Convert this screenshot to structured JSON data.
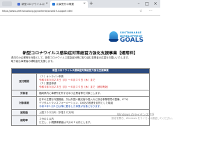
{
  "browser": {
    "tabs": [
      {
        "title": "新型コロナウイルス感染症対策経営力",
        "active": false
      },
      {
        "title": "応募受付の概要",
        "active": true
      }
    ],
    "new_tab_glyph": "+",
    "url": "https://www.pref.fukuoka.lg.jp/contents/covid19-support.html"
  },
  "logo": {
    "line1": "SUSTAINABLE",
    "line2": "DEVELOPMENT",
    "line3": "GOALS"
  },
  "page": {
    "title": "新型コロナウイルス感染症対策経営力強化支援事業【通常枠】",
    "intro_line1": "県内中小企業等を対象として、新型コロナウイルス感染症対策に取り組む事業者の応募をお願いいたします。",
    "intro_line2": "取り組む事業者の補助金を支援します。"
  },
  "table": {
    "header": "新型コロナウイルス感染症対策経営力強化支援事業",
    "rows": [
      {
        "label": "受付期間",
        "lines": [
          {
            "text": "（１）オンライン申請",
            "color": "normal"
          },
          {
            "text": "令和４年５月２３日（月）～６月３０日（木）まで",
            "color": "red"
          },
          {
            "text": "（２）郵送申請",
            "color": "normal"
          },
          {
            "text": "令和４年５月２３日（月）～６月３０日（木）まで（消印有効）",
            "color": "red"
          }
        ]
      },
      {
        "label": "対象者",
        "lines": [
          {
            "text": "福岡県内に事業所を有する中小企業者等を対象とします。",
            "color": "normal"
          }
        ]
      },
      {
        "label": "対象事業",
        "lines": [
          {
            "text": "日本の主要な外国籍者、又は外国人観光客の受入れに係る事業環境の整備、ICTの",
            "color": "normal"
          },
          {
            "text": "デジタルトランスフォーメーション、DX化の推進を目的とした取組",
            "color": "normal"
          },
          {
            "text": "令和４年１月１日以降に着手した事業が対象となります。",
            "color": "blue"
          }
        ]
      },
      {
        "label": "補助額",
        "lines": [
          {
            "text": "上限２００万円（下限１０万円）",
            "color": "normal"
          }
        ]
      },
      {
        "label": "補助率",
        "lines": [
          {
            "text": "２分の１以内",
            "color": "normal"
          },
          {
            "text": "ただし、小規模事業者は３分の２以内とします。",
            "color": "normal"
          }
        ]
      }
    ]
  },
  "watermark": {
    "line1": "Windows のライセンス認証",
    "line2": "設定を開き、Windows をライセンス認証してください。"
  }
}
